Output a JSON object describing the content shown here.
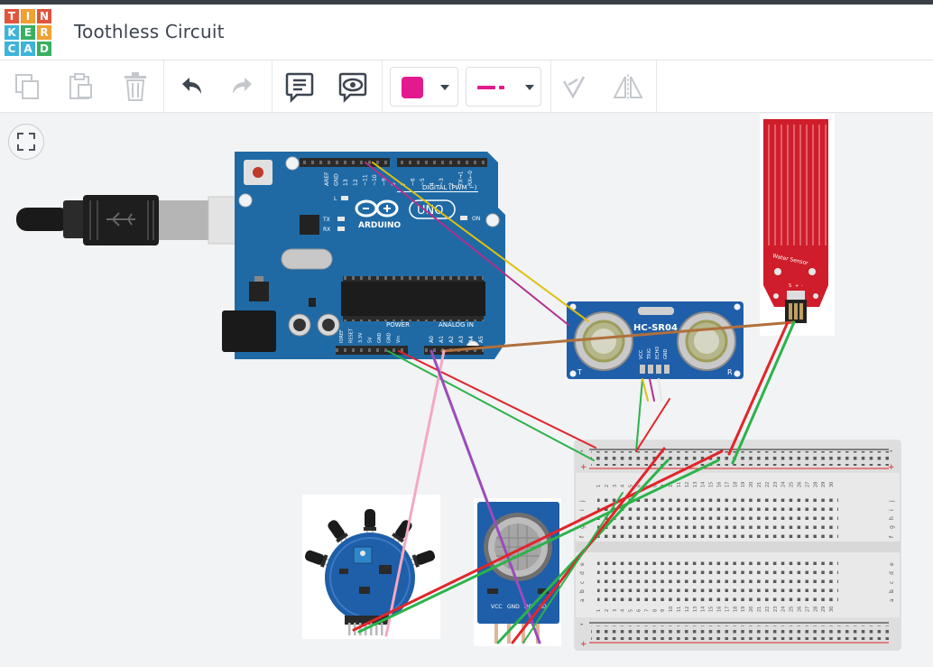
{
  "app": {
    "logo_letters": [
      "T",
      "I",
      "N",
      "K",
      "E",
      "R",
      "C",
      "A",
      "D"
    ],
    "logo_colors": [
      "#e3543c",
      "#f0a131",
      "#e3543c",
      "#3db4d8",
      "#39b060",
      "#f0a131",
      "#3db4d8",
      "#3db4d8",
      "#39b060"
    ],
    "title": "Toothless Circuit"
  },
  "toolbar": {
    "fill_color": "#e21a8e",
    "line_color": "#e21a8e",
    "icons": [
      "copy-icon",
      "paste-icon",
      "delete-icon",
      "undo-icon",
      "redo-icon",
      "note-icon",
      "notes-visibility-icon",
      "color-picker",
      "line-style-picker",
      "align-icon",
      "flip-icon"
    ]
  },
  "arduino": {
    "reset_hint": "RESET",
    "header_labels": [
      "AREF",
      "GND",
      "13",
      "12",
      "~11",
      "~10",
      "~9",
      "8",
      "7",
      "~6",
      "~5",
      "4",
      "~3",
      "2",
      "TX→1",
      "RX←0"
    ],
    "digital_label": "DIGITAL (PWM ~)",
    "brand": "ARDUINO",
    "model": "UNO",
    "led_l": "L",
    "led_tx": "TX",
    "led_rx": "RX",
    "on_label": "ON",
    "power_label": "POWER",
    "analog_label": "ANALOG IN",
    "power_pins": [
      "IOREF",
      "RESET",
      "3.3V",
      "5V",
      "GND",
      "GND",
      "Vin"
    ],
    "analog_pins": [
      "A0",
      "A1",
      "A2",
      "A3",
      "A4",
      "A5"
    ]
  },
  "ultrasonic": {
    "model": "HC-SR04",
    "pins": [
      "VCC",
      "TRIG",
      "ECHO",
      "GND"
    ],
    "left_mark": "T",
    "right_mark": "R"
  },
  "water_sensor": {
    "label": "Water Sensor",
    "pin_marks": [
      "S",
      "+",
      "-"
    ]
  },
  "gas_sensor": {
    "pin_labels": [
      "VCC",
      "GND",
      "DO",
      "AO"
    ]
  },
  "breadboard": {
    "column_numbers_top": [
      "1",
      "2",
      "3",
      "4",
      "5",
      "6",
      "7",
      "8",
      "9",
      "10",
      "11",
      "12",
      "13",
      "14",
      "15",
      "16",
      "17",
      "18",
      "19",
      "20",
      "21",
      "22",
      "23",
      "24",
      "25",
      "26",
      "27",
      "28",
      "29",
      "30"
    ],
    "row_letters_top": [
      "j",
      "i",
      "h",
      "g",
      "f"
    ],
    "row_letters_bottom": [
      "e",
      "d",
      "c",
      "b",
      "a"
    ],
    "rail_minus": "-",
    "rail_plus": "+"
  }
}
